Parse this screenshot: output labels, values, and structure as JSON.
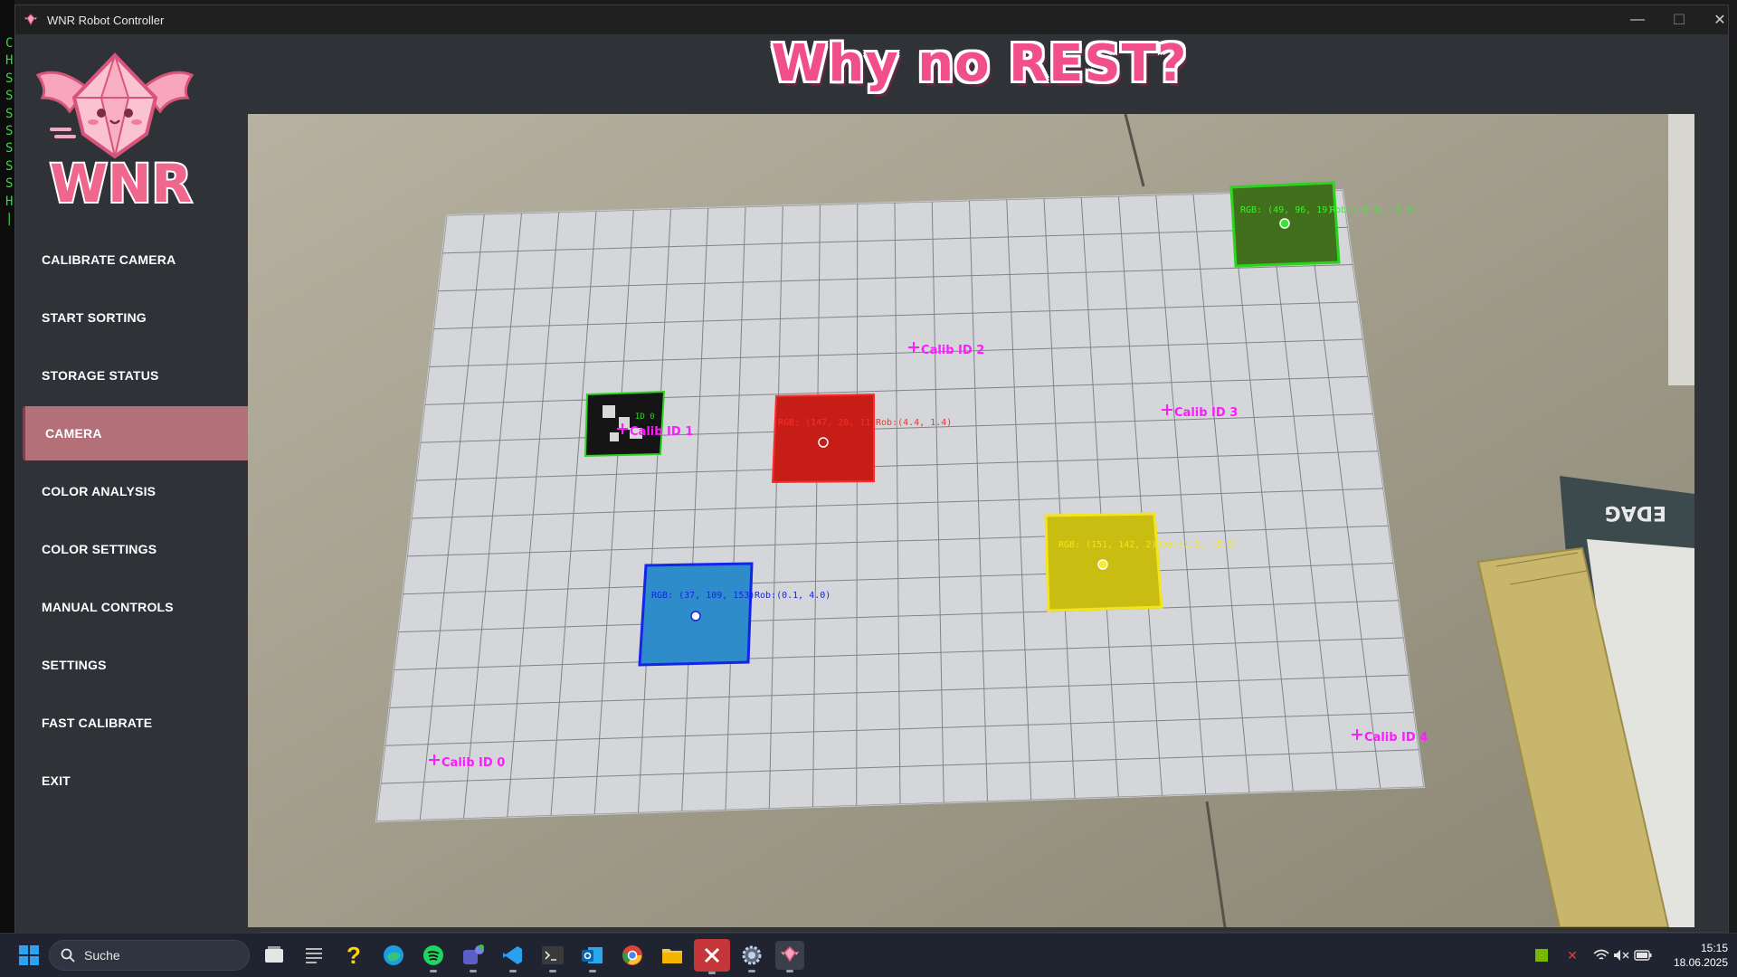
{
  "window": {
    "title": "WNR Robot Controller",
    "controls": {
      "minimize": "—",
      "maximize": "☐",
      "close": "✕"
    }
  },
  "header": {
    "title": "Why no REST?",
    "title_color": "#f04f8a"
  },
  "logo": {
    "text": "WNR",
    "color": "#f0678e"
  },
  "sidebar": {
    "items": [
      {
        "label": "CALIBRATE CAMERA",
        "active": false
      },
      {
        "label": "START SORTING",
        "active": false
      },
      {
        "label": "STORAGE STATUS",
        "active": false
      },
      {
        "label": "CAMERA",
        "active": true
      },
      {
        "label": "COLOR ANALYSIS",
        "active": false
      },
      {
        "label": "COLOR SETTINGS",
        "active": false
      },
      {
        "label": "MANUAL CONTROLS",
        "active": false
      },
      {
        "label": "SETTINGS",
        "active": false
      },
      {
        "label": "FAST CALIBRATE",
        "active": false
      },
      {
        "label": "EXIT",
        "active": false
      }
    ],
    "active_color": "#b37079"
  },
  "camera": {
    "calib_markers": [
      {
        "label": "Calib ID 0"
      },
      {
        "label": "Calib ID 1"
      },
      {
        "label": "Calib ID 2"
      },
      {
        "label": "Calib ID 3"
      },
      {
        "label": "Calib ID 4"
      }
    ],
    "objects": [
      {
        "color": "green",
        "rgb": "RGB: (49, 96, 19)",
        "rob": "Rob:(-0.0, -0.0)"
      },
      {
        "color": "red",
        "rgb": "RGB: (147, 28, 11)",
        "rob": "Rob:(4.4, 1.4)"
      },
      {
        "color": "yellow",
        "rgb": "RGB: (151, 142, 2)",
        "rob": "Rob:(1.0, -5.0)"
      },
      {
        "color": "blue",
        "rgb": "RGB: (37, 109, 153)",
        "rob": "Rob:(0.1, 4.0)"
      }
    ],
    "aruco_label": "ID 0",
    "booklet_text": "EDAG"
  },
  "terminal": {
    "lines": [
      "C",
      "H",
      "S",
      "S",
      "S",
      "S",
      "S",
      "S",
      "S",
      "H",
      "|"
    ]
  },
  "taskbar": {
    "search_label": "Suche",
    "time": "15:15",
    "date": "18.06.2025",
    "apps": [
      "task-view",
      "notes",
      "help",
      "edge",
      "spotify",
      "teams",
      "vscode",
      "terminal",
      "outlook",
      "chrome",
      "file-explorer",
      "xampp",
      "settings",
      "wnr-app"
    ]
  }
}
